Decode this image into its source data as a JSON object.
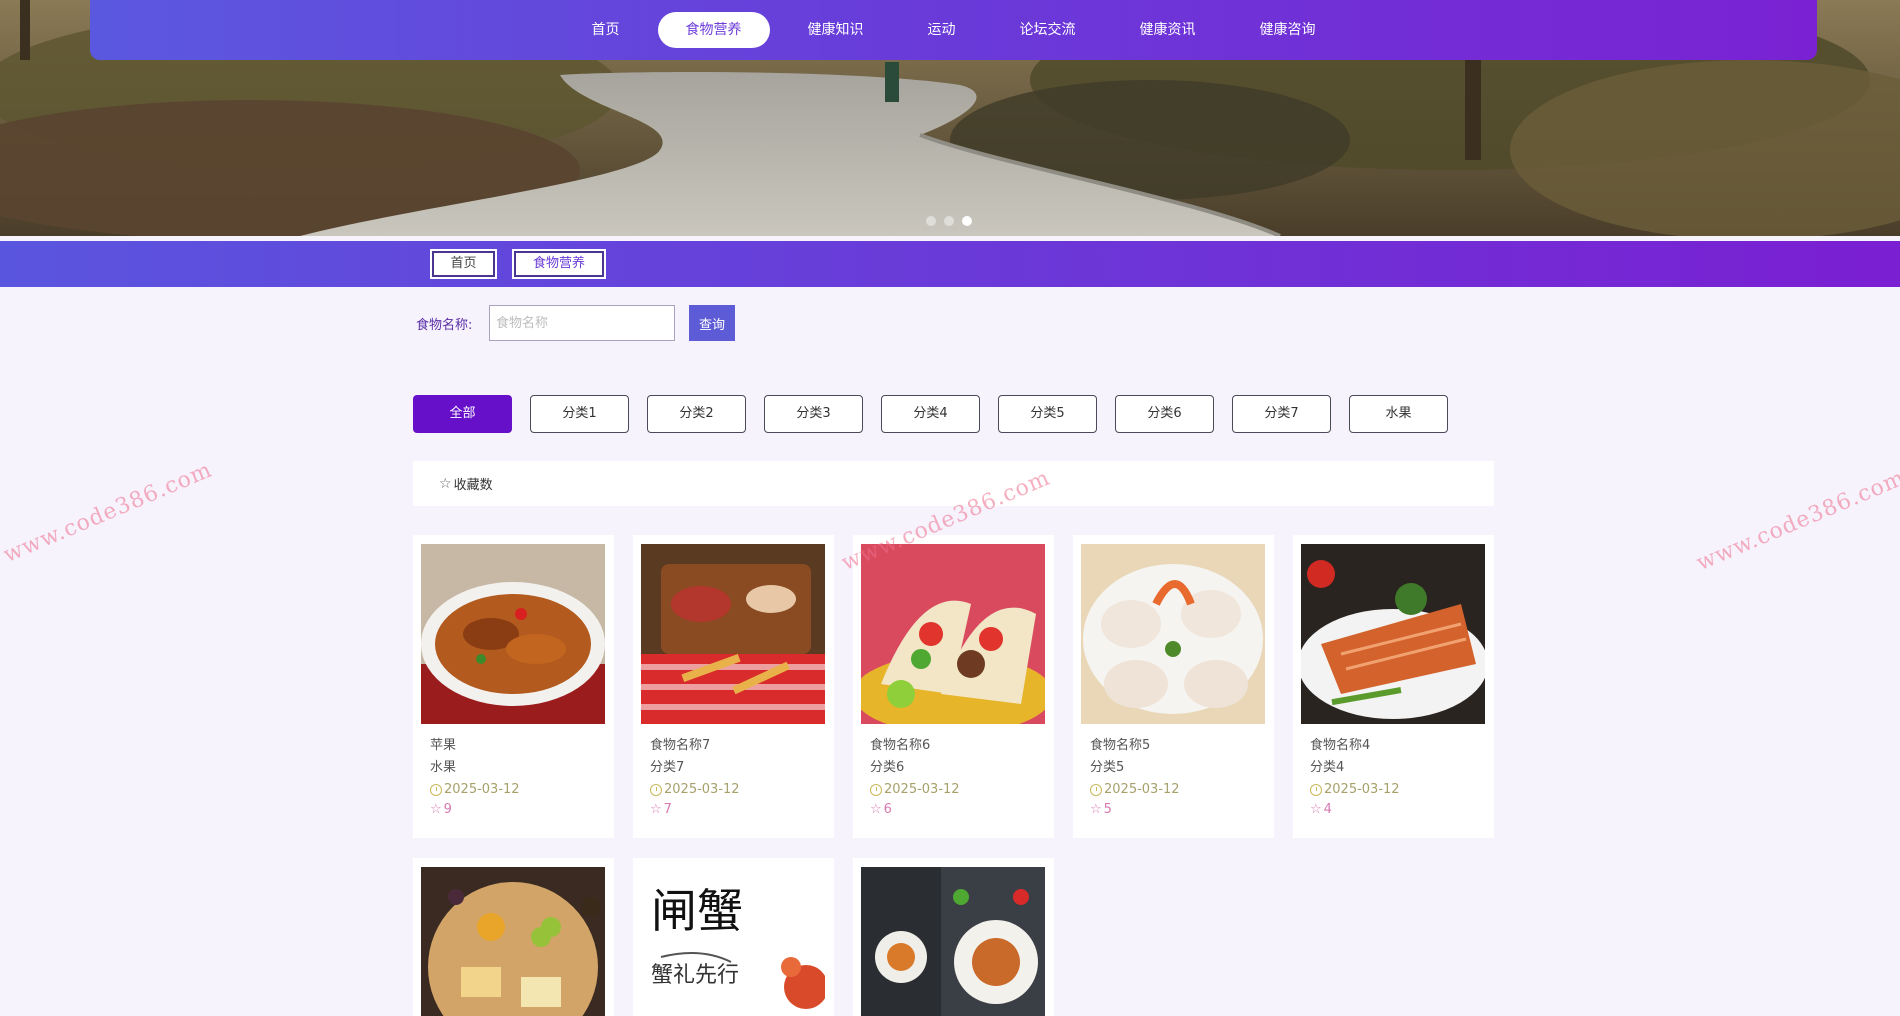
{
  "nav": {
    "items": [
      "首页",
      "食物营养",
      "健康知识",
      "运动",
      "论坛交流",
      "健康资讯",
      "健康咨询"
    ],
    "active_index": 1
  },
  "banner": {
    "dot_count": 3,
    "active_dot": 2
  },
  "breadcrumb": {
    "home": "首页",
    "current": "食物营养"
  },
  "search": {
    "label": "食物名称:",
    "placeholder": "食物名称",
    "value": "",
    "button": "查询"
  },
  "categories": {
    "items": [
      "全部",
      "分类1",
      "分类2",
      "分类3",
      "分类4",
      "分类5",
      "分类6",
      "分类7",
      "水果"
    ],
    "active_index": 0
  },
  "sort": {
    "star_icon": "☆",
    "label": "收藏数"
  },
  "cards": [
    {
      "name": "苹果",
      "category": "水果",
      "date": "2025-03-12",
      "favorites": "9",
      "image": "chicken-wings"
    },
    {
      "name": "食物名称7",
      "category": "分类7",
      "date": "2025-03-12",
      "favorites": "7",
      "image": "bbq-spread"
    },
    {
      "name": "食物名称6",
      "category": "分类6",
      "date": "2025-03-12",
      "favorites": "6",
      "image": "tacos"
    },
    {
      "name": "食物名称5",
      "category": "分类5",
      "date": "2025-03-12",
      "favorites": "5",
      "image": "shrimp-dumplings"
    },
    {
      "name": "食物名称4",
      "category": "分类4",
      "date": "2025-03-12",
      "favorites": "4",
      "image": "salmon"
    },
    {
      "name": "",
      "category": "",
      "date": "",
      "favorites": "",
      "image": "cheese-board"
    },
    {
      "name": "",
      "category": "",
      "date": "",
      "favorites": "",
      "image": "crab-calligraphy"
    },
    {
      "name": "",
      "category": "",
      "date": "",
      "favorites": "",
      "image": "plated-dishes"
    }
  ],
  "watermark": "www.code386.com",
  "colors": {
    "nav_gradient_start": "#5b58e0",
    "nav_gradient_end": "#7a22d3",
    "active_category": "#6611c9",
    "search_button": "#5e5bd6",
    "date_text": "#a8a06a",
    "fav_text": "#d87ab1"
  }
}
